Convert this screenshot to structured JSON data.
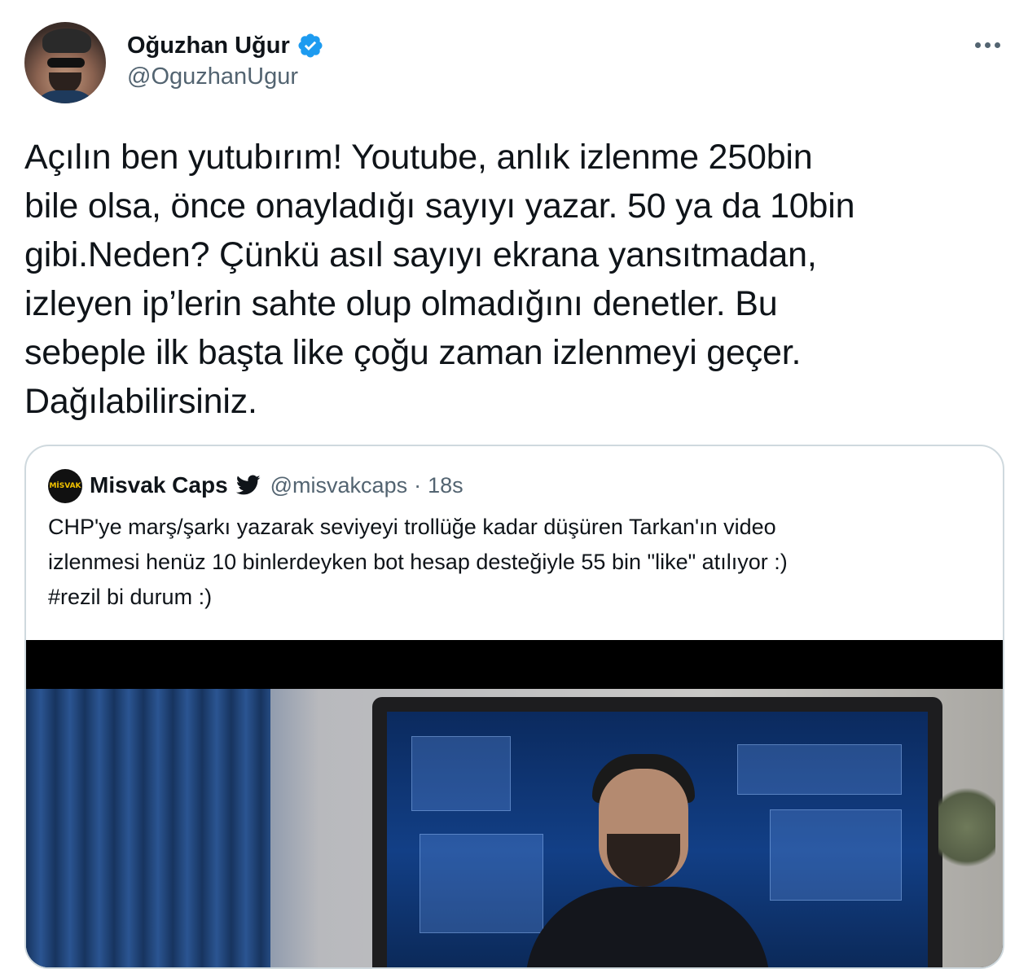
{
  "author": {
    "display_name": "Oğuzhan Uğur",
    "handle": "@OguzhanUgur",
    "verified": true
  },
  "tweet": {
    "text": "Açılın ben yutubırım! Youtube, anlık izlenme 250bin\nbile olsa, önce onayladığı sayıyı yazar. 50 ya da 10bin\ngibi.Neden? Çünkü asıl sayıyı ekrana yansıtmadan,\nizleyen ip’lerin sahte olup olmadığını denetler. Bu\nsebeple ilk başta like çoğu zaman izlenmeyi geçer.\nDağılabilirsiniz."
  },
  "quoted_tweet": {
    "avatar_text": "MİSVAK",
    "display_name": "Misvak Caps",
    "handle": "@misvakcaps",
    "separator": "·",
    "time": "18s",
    "text": "CHP'ye marş/şarkı yazarak seviyeyi trollüğe kadar düşüren Tarkan'ın video\nizlenmesi henüz 10 binlerdeyken bot hesap desteğiyle 55 bin \"like\" atılıyor :)\n#rezil bi durum :)"
  },
  "icons": {
    "verified": "verified-badge-icon",
    "more": "more-options-icon",
    "bird": "twitter-bird-icon"
  },
  "colors": {
    "text_primary": "#0f1419",
    "text_secondary": "#536471",
    "verified_blue": "#1d9bf0",
    "border": "#cfd9de"
  }
}
